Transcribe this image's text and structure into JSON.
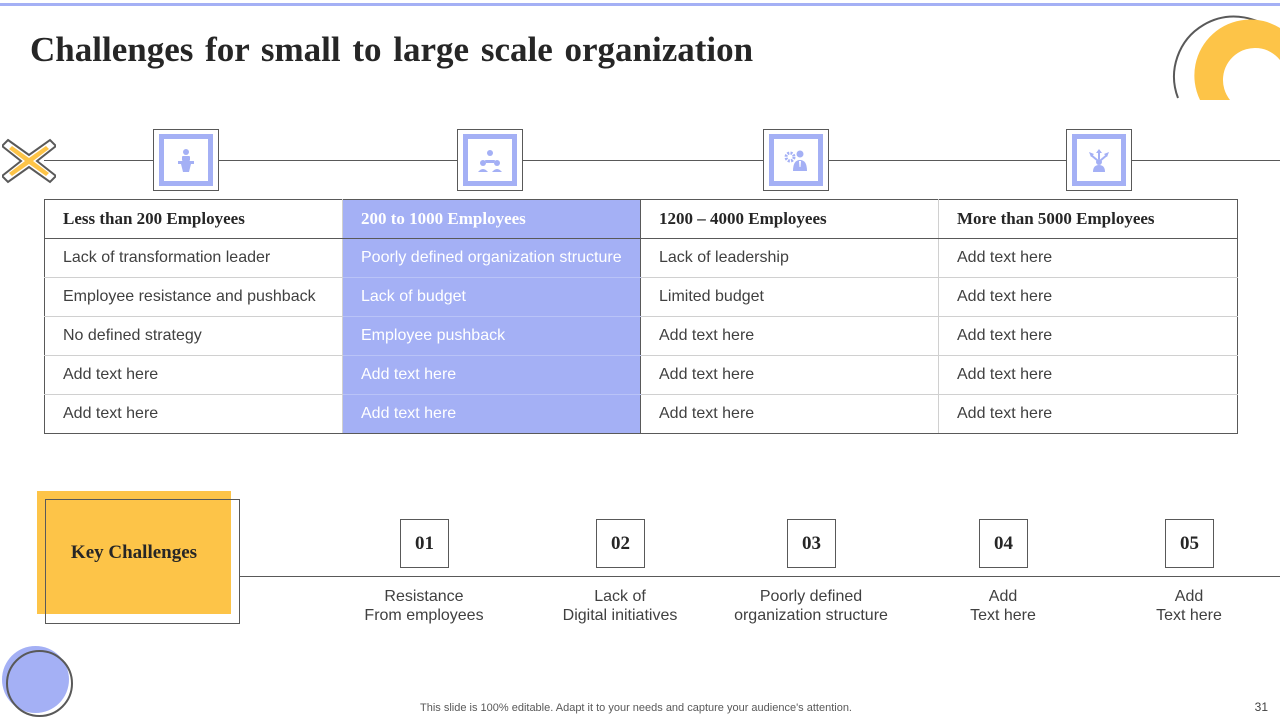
{
  "slide": {
    "title": "Challenges for small to large scale organization",
    "footer": "This slide is 100% editable. Adapt it to your needs and capture your audience's attention.",
    "page_number": "31"
  },
  "colors": {
    "accent_blue": "#a4b0f5",
    "accent_yellow": "#fdc448",
    "line_gray": "#595959"
  },
  "icons": [
    "presenter-icon",
    "team-icon",
    "manager-gear-icon",
    "network-person-icon"
  ],
  "table": {
    "headers": [
      "Less than 200 Employees",
      "200 to 1000 Employees",
      "1200 – 4000 Employees",
      "More than 5000 Employees"
    ],
    "rows": [
      [
        "Lack of transformation leader",
        "Poorly defined organization structure",
        "Lack of leadership",
        "Add text here"
      ],
      [
        "Employee resistance and pushback",
        "Lack of budget",
        "Limited budget",
        "Add text here"
      ],
      [
        "No defined strategy",
        "Employee pushback",
        "Add text here",
        "Add text here"
      ],
      [
        "Add text here",
        "Add text here",
        "Add text here",
        "Add text here"
      ],
      [
        "Add text here",
        "Add text here",
        "Add text here",
        "Add text here"
      ]
    ]
  },
  "key_challenges": {
    "label": "Key Challenges",
    "items": [
      {
        "number": "01",
        "line1": "Resistance",
        "line2": "From employees"
      },
      {
        "number": "02",
        "line1": "Lack of",
        "line2": "Digital initiatives"
      },
      {
        "number": "03",
        "line1": "Poorly defined",
        "line2": "organization structure"
      },
      {
        "number": "04",
        "line1": "Add",
        "line2": "Text here"
      },
      {
        "number": "05",
        "line1": "Add",
        "line2": "Text here"
      }
    ]
  }
}
